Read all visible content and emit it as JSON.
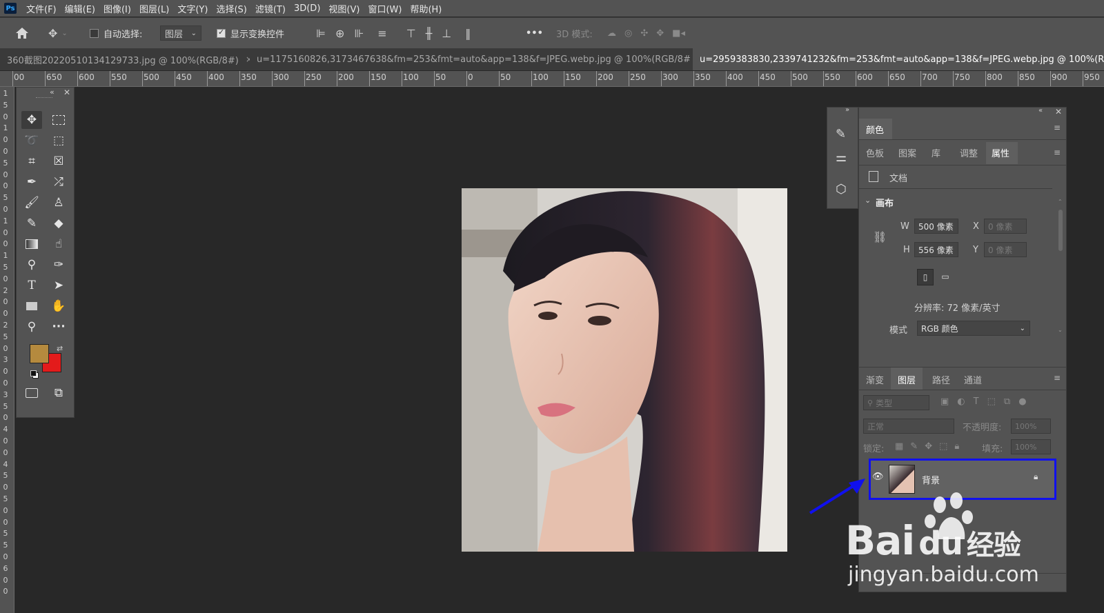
{
  "app": {
    "logo": "Ps"
  },
  "menu": [
    "文件(F)",
    "编辑(E)",
    "图像(I)",
    "图层(L)",
    "文字(Y)",
    "选择(S)",
    "滤镜(T)",
    "3D(D)",
    "视图(V)",
    "窗口(W)",
    "帮助(H)"
  ],
  "options": {
    "auto_select_label": "自动选择:",
    "auto_select_target": "图层",
    "show_transform_label": "显示变换控件",
    "mode_3d_label": "3D 模式:",
    "more": "•••"
  },
  "tabs": [
    {
      "label": "360截图20220510134129733.jpg @ 100%(RGB/8#)",
      "close": "×"
    },
    {
      "label": "u=1175160826,3173467638&fm=253&fmt=auto&app=138&f=JPEG.webp.jpg @ 100%(RGB/8#)",
      "close": "×"
    },
    {
      "label": "u=2959383830,2339741232&fm=253&fmt=auto&app=138&f=JPEG.webp.jpg @ 100%(RGB/8"
    }
  ],
  "ruler_top": [
    "00",
    "650",
    "600",
    "550",
    "500",
    "450",
    "400",
    "350",
    "300",
    "250",
    "200",
    "150",
    "100",
    "50",
    "0",
    "50",
    "100",
    "150",
    "200",
    "250",
    "300",
    "350",
    "400",
    "450",
    "500",
    "550",
    "600",
    "650",
    "700",
    "750",
    "800",
    "850",
    "900",
    "950"
  ],
  "ruler_left": [
    "1",
    "5",
    "0",
    "1",
    "0",
    "0",
    "5",
    "0",
    "0",
    "5",
    "0",
    "1",
    "0",
    "0",
    "1",
    "5",
    "0",
    "2",
    "0",
    "0",
    "2",
    "5",
    "0",
    "3",
    "0",
    "0",
    "3",
    "5",
    "0",
    "4",
    "0",
    "0",
    "4",
    "5",
    "0",
    "5",
    "0",
    "0",
    "5",
    "5",
    "0",
    "6",
    "0",
    "0"
  ],
  "toolbox_icons": [
    "move-icon",
    "marquee-icon",
    "lasso-icon",
    "object-select-icon",
    "crop-icon",
    "frame-icon",
    "eyedropper-icon",
    "healing-icon",
    "brush-icon",
    "stamp-icon",
    "history-brush-icon",
    "eraser-icon",
    "gradient-icon",
    "smudge-icon",
    "dodge-icon",
    "pen-icon",
    "type-icon",
    "path-select-icon",
    "rectangle-icon",
    "hand-icon",
    "zoom-icon",
    "more-tools-icon"
  ],
  "colors": {
    "foreground": "#b58a3e",
    "background": "#e31b1b",
    "highlight": "#1010ee"
  },
  "properties_panel": {
    "title_tab": "颜色",
    "tabs": [
      "色板",
      "图案",
      "库",
      "调整",
      "属性"
    ],
    "active_tab": "属性",
    "doc_label": "文档",
    "section": "画布",
    "w_label": "W",
    "w_value": "500 像素",
    "h_label": "H",
    "h_value": "556 像素",
    "x_label": "X",
    "x_value": "0 像素",
    "y_label": "Y",
    "y_value": "0 像素",
    "resolution": "分辨率: 72 像素/英寸",
    "mode_label": "模式",
    "mode_value": "RGB 颜色"
  },
  "layers_panel": {
    "tabs": [
      "渐变",
      "图层",
      "路径",
      "通道"
    ],
    "active_tab": "图层",
    "filter_placeholder": "类型",
    "blend_mode": "正常",
    "opacity_label": "不透明度:",
    "opacity_value": "100%",
    "lock_label": "锁定:",
    "fill_label": "填充:",
    "fill_value": "100%",
    "layers": [
      {
        "name": "背景",
        "locked": true,
        "visible": true
      }
    ]
  },
  "watermark": {
    "brand": "Bai",
    "brand_suffix": "经验",
    "url": "jingyan.baidu.com"
  }
}
